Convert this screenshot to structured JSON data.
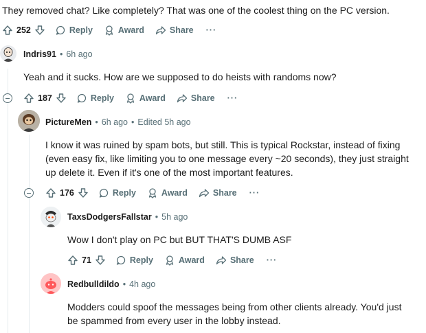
{
  "top": {
    "text": "They removed chat? Like completely? That was one of the coolest thing on the PC version.",
    "votes": "252"
  },
  "c1": {
    "author": "Indris91",
    "time": "6h ago",
    "text": "Yeah and it sucks. How are we supposed to do heists with randoms now?",
    "votes": "187"
  },
  "c2": {
    "author": "PictureMen",
    "time": "6h ago",
    "edited": "Edited 5h ago",
    "text": "I know it was ruined by spam bots, but still. This is typical Rockstar, instead of fixing (even easy fix, like limiting you to one message every ~20 seconds), they just straight up delete it. Even if it's one of the most important features.",
    "votes": "176"
  },
  "c3": {
    "author": "TaxsDodgersFallstar",
    "time": "5h ago",
    "text": "Wow I don't play on PC but BUT THAT'S DUMB ASF",
    "votes": "71"
  },
  "c4": {
    "author": "Redbulldildo",
    "time": "4h ago",
    "text": "Modders could spoof the messages being from other clients already. You'd just be spammed from every user in the lobby instead."
  },
  "labels": {
    "reply": "Reply",
    "award": "Award",
    "share": "Share",
    "more": "···",
    "dot": "•"
  },
  "icons": [
    "upvote-icon",
    "downvote-icon",
    "reply-icon",
    "award-icon",
    "share-icon",
    "more-icon",
    "collapse-icon"
  ],
  "colors": {
    "meta": "#576f76",
    "text": "#1c1c1c",
    "thread": "#e5ebee",
    "avatar_red": "#ff585b"
  }
}
